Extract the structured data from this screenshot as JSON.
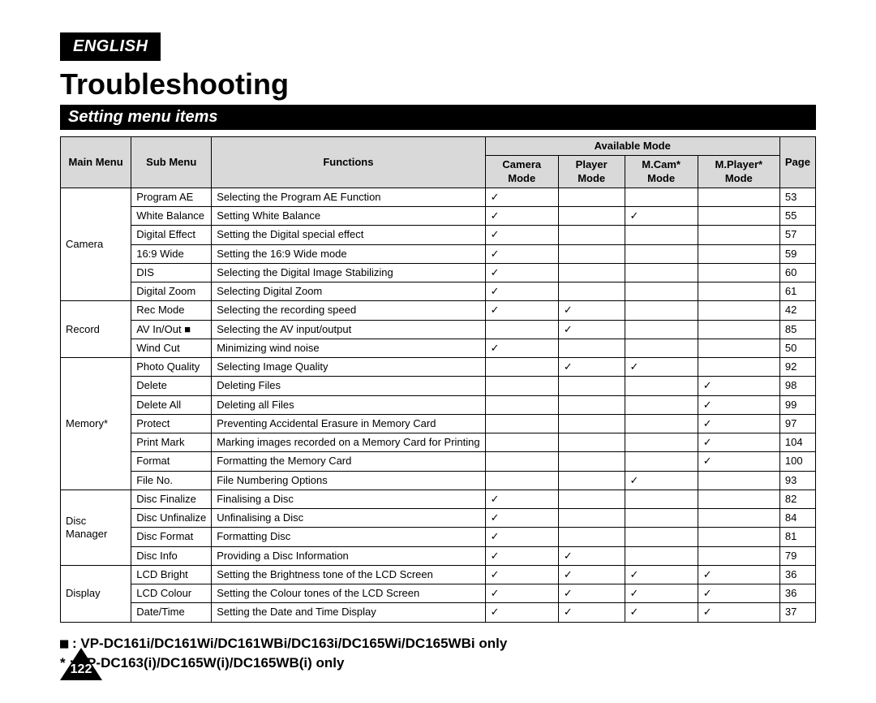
{
  "lang": "ENGLISH",
  "title": "Troubleshooting",
  "section": "Setting menu items",
  "headers": {
    "main": "Main Menu",
    "sub": "Sub Menu",
    "func": "Functions",
    "avail": "Available Mode",
    "cam": "Camera Mode",
    "player": "Player Mode",
    "mcam": "M.Cam* Mode",
    "mplayer": "M.Player* Mode",
    "page": "Page"
  },
  "tick": "✓",
  "groups": [
    {
      "main": "Camera",
      "rows": [
        {
          "sub": "Program AE",
          "func": "Selecting the Program AE Function",
          "cam": "✓",
          "player": "",
          "mcam": "",
          "mplayer": "",
          "page": "53"
        },
        {
          "sub": "White Balance",
          "func": "Setting White Balance",
          "cam": "✓",
          "player": "",
          "mcam": "✓",
          "mplayer": "",
          "page": "55"
        },
        {
          "sub": "Digital Effect",
          "func": "Setting the Digital special effect",
          "cam": "✓",
          "player": "",
          "mcam": "",
          "mplayer": "",
          "page": "57"
        },
        {
          "sub": "16:9 Wide",
          "func": "Setting the 16:9 Wide mode",
          "cam": "✓",
          "player": "",
          "mcam": "",
          "mplayer": "",
          "page": "59"
        },
        {
          "sub": "DIS",
          "func": "Selecting the Digital Image Stabilizing",
          "cam": "✓",
          "player": "",
          "mcam": "",
          "mplayer": "",
          "page": "60"
        },
        {
          "sub": "Digital Zoom",
          "func": "Selecting Digital Zoom",
          "cam": "✓",
          "player": "",
          "mcam": "",
          "mplayer": "",
          "page": "61"
        }
      ]
    },
    {
      "main": "Record",
      "rows": [
        {
          "sub": "Rec Mode",
          "func": "Selecting the recording speed",
          "cam": "✓",
          "player": "✓",
          "mcam": "",
          "mplayer": "",
          "page": "42"
        },
        {
          "sub": "AV In/Out ■",
          "func": "Selecting the AV input/output",
          "cam": "",
          "player": "✓",
          "mcam": "",
          "mplayer": "",
          "page": "85"
        },
        {
          "sub": "Wind Cut",
          "func": "Minimizing wind noise",
          "cam": "✓",
          "player": "",
          "mcam": "",
          "mplayer": "",
          "page": "50"
        }
      ]
    },
    {
      "main": "Memory*",
      "rows": [
        {
          "sub": "Photo Quality",
          "func": "Selecting Image Quality",
          "cam": "",
          "player": "✓",
          "mcam": "✓",
          "mplayer": "",
          "page": "92"
        },
        {
          "sub": "Delete",
          "func": "Deleting Files",
          "cam": "",
          "player": "",
          "mcam": "",
          "mplayer": "✓",
          "page": "98"
        },
        {
          "sub": "Delete All",
          "func": "Deleting all Files",
          "cam": "",
          "player": "",
          "mcam": "",
          "mplayer": "✓",
          "page": "99"
        },
        {
          "sub": "Protect",
          "func": "Preventing Accidental Erasure in Memory Card",
          "cam": "",
          "player": "",
          "mcam": "",
          "mplayer": "✓",
          "page": "97"
        },
        {
          "sub": "Print Mark",
          "func": "Marking images recorded on a Memory Card for Printing",
          "cam": "",
          "player": "",
          "mcam": "",
          "mplayer": "✓",
          "page": "104"
        },
        {
          "sub": "Format",
          "func": "Formatting the Memory Card",
          "cam": "",
          "player": "",
          "mcam": "",
          "mplayer": "✓",
          "page": "100"
        },
        {
          "sub": "File No.",
          "func": "File Numbering Options",
          "cam": "",
          "player": "",
          "mcam": "✓",
          "mplayer": "",
          "page": "93"
        }
      ]
    },
    {
      "main": "Disc Manager",
      "rows": [
        {
          "sub": "Disc Finalize",
          "func": "Finalising a Disc",
          "cam": "✓",
          "player": "",
          "mcam": "",
          "mplayer": "",
          "page": "82"
        },
        {
          "sub": "Disc Unfinalize",
          "func": "Unfinalising a Disc",
          "cam": "✓",
          "player": "",
          "mcam": "",
          "mplayer": "",
          "page": "84"
        },
        {
          "sub": "Disc Format",
          "func": "Formatting Disc",
          "cam": "✓",
          "player": "",
          "mcam": "",
          "mplayer": "",
          "page": "81"
        },
        {
          "sub": "Disc Info",
          "func": "Providing a Disc Information",
          "cam": "✓",
          "player": "✓",
          "mcam": "",
          "mplayer": "",
          "page": "79"
        }
      ]
    },
    {
      "main": "Display",
      "rows": [
        {
          "sub": "LCD Bright",
          "func": "Setting the Brightness tone of the LCD Screen",
          "cam": "✓",
          "player": "✓",
          "mcam": "✓",
          "mplayer": "✓",
          "page": "36"
        },
        {
          "sub": "LCD Colour",
          "func": "Setting the Colour tones of the LCD Screen",
          "cam": "✓",
          "player": "✓",
          "mcam": "✓",
          "mplayer": "✓",
          "page": "36"
        },
        {
          "sub": "Date/Time",
          "func": "Setting the Date and Time Display",
          "cam": "✓",
          "player": "✓",
          "mcam": "✓",
          "mplayer": "✓",
          "page": "37"
        }
      ]
    }
  ],
  "footnotes": {
    "line1_prefix": "■",
    "line1": ": VP-DC161i/DC161Wi/DC161WBi/DC163i/DC165Wi/DC165WBi only",
    "line2_prefix": "*",
    "line2": "  : VP-DC163(i)/DC165W(i)/DC165WB(i) only"
  },
  "pageNumber": "122"
}
